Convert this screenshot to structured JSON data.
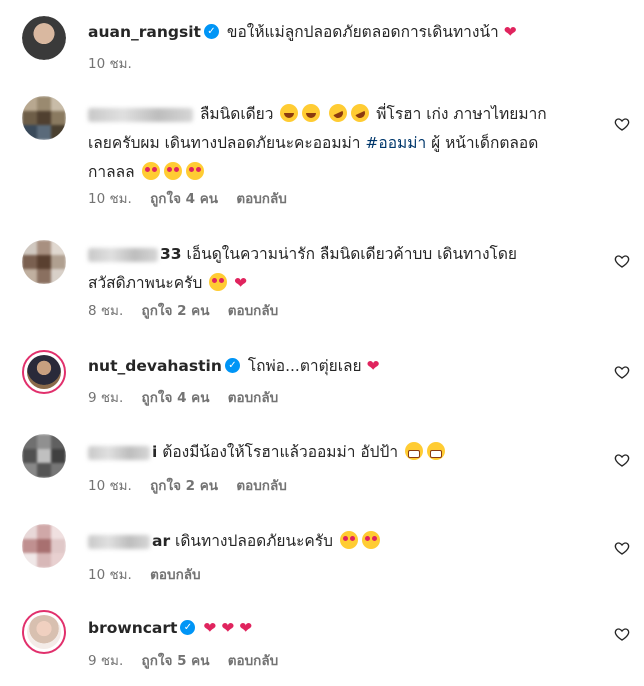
{
  "comments": [
    {
      "username": "auan_rangsit",
      "verified": true,
      "text": "ขอให้แม่ลูกปลอดภัยตลอดการเดินทางน้า",
      "time": "10 ชม."
    },
    {
      "text_line1": "ลืมนิดเดียว",
      "text_line1b": "พี่โรฮา เก่ง ภาษาไทยมาก",
      "text_line2": "เลยครับผม เดินทางปลอดภัยนะคะออมม่า",
      "hashtag": "#ออมม่า",
      "text_line2b": "ผู้ หน้าเด็กตลอด",
      "text_line3": "กาลลล",
      "time": "10 ชม.",
      "likes": "ถูกใจ 4 คน",
      "reply": "ตอบกลับ"
    },
    {
      "name_suffix": "33",
      "text_line1": "เอ็นดูในความน่ารัก ลืมนิดเดียวค้าบบ เดินทางโดย",
      "text_line2": "สวัสดิภาพนะครับ",
      "time": "8 ชม.",
      "likes": "ถูกใจ 2 คน",
      "reply": "ตอบกลับ"
    },
    {
      "username": "nut_devahastin",
      "verified": true,
      "text": "โถพ่อ...ตาตุ่ยเลย",
      "time": "9 ชม.",
      "likes": "ถูกใจ 4 คน",
      "reply": "ตอบกลับ"
    },
    {
      "name_suffix": "i",
      "text": "ต้องมีน้องให้โรฮาแล้วออมม่า อัปป้า",
      "time": "10 ชม.",
      "likes": "ถูกใจ 2 คน",
      "reply": "ตอบกลับ"
    },
    {
      "name_suffix": "ar",
      "text": "เดินทางปลอดภัยนะครับ",
      "time": "10 ชม.",
      "reply": "ตอบกลับ"
    },
    {
      "username": "browncart",
      "verified": true,
      "time": "9 ชม.",
      "likes": "ถูกใจ 5 คน",
      "reply": "ตอบกลับ"
    }
  ],
  "icons": {
    "verified": "verified-badge-icon",
    "heart_emoji": "red-heart-icon",
    "like": "heart-outline-icon"
  },
  "colors": {
    "verified": "#0095f6",
    "heart": "#e0245e",
    "meta": "#737373",
    "story_ring": "#e1306c"
  }
}
